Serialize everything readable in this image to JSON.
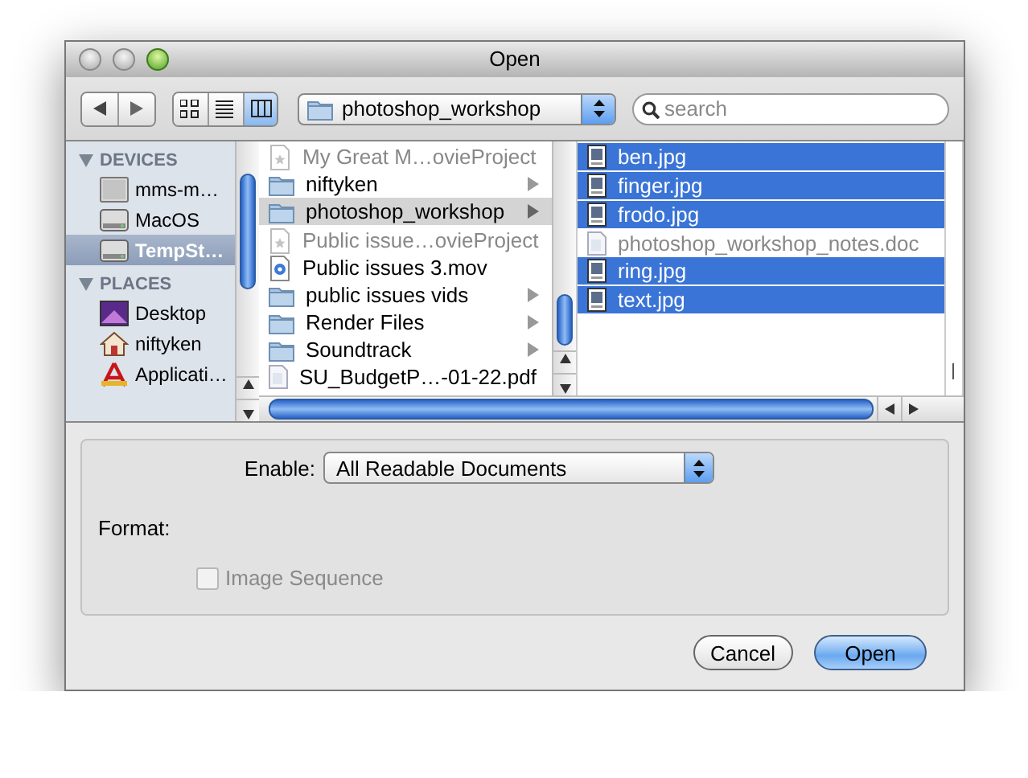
{
  "window": {
    "title": "Open"
  },
  "toolbar": {
    "view_modes": [
      {
        "kind": "icons",
        "selected": false
      },
      {
        "kind": "list",
        "selected": false
      },
      {
        "kind": "columns",
        "selected": true
      }
    ],
    "location": "photoshop_workshop",
    "search": {
      "placeholder": "search"
    }
  },
  "sidebar": {
    "sections": [
      {
        "title": "DEVICES",
        "expanded": true,
        "items": [
          {
            "label": "mms-m…",
            "kind": "computer",
            "selected": false
          },
          {
            "label": "MacOS",
            "kind": "disk",
            "selected": false
          },
          {
            "label": "TempSt…",
            "kind": "disk",
            "selected": true
          }
        ]
      },
      {
        "title": "PLACES",
        "expanded": true,
        "items": [
          {
            "label": "Desktop",
            "kind": "desktop",
            "selected": false
          },
          {
            "label": "niftyken",
            "kind": "home",
            "selected": false
          },
          {
            "label": "Applicati…",
            "kind": "apps",
            "selected": false
          }
        ]
      }
    ]
  },
  "columns": [
    {
      "items": [
        {
          "name": "My Great M…ovieProject",
          "kind": "project",
          "disabled": true,
          "selected": false
        },
        {
          "name": "niftyken",
          "kind": "folder",
          "disabled": false,
          "selected": false
        },
        {
          "name": "photoshop_workshop",
          "kind": "folder",
          "disabled": false,
          "selected": true
        },
        {
          "name": "Public issue…ovieProject",
          "kind": "project",
          "disabled": true,
          "selected": false
        },
        {
          "name": "Public issues 3.mov",
          "kind": "movie",
          "disabled": false,
          "selected": false
        },
        {
          "name": "public issues vids",
          "kind": "folder",
          "disabled": false,
          "selected": false
        },
        {
          "name": "Render Files",
          "kind": "folder",
          "disabled": false,
          "selected": false
        },
        {
          "name": "Soundtrack",
          "kind": "folder",
          "disabled": false,
          "selected": false
        },
        {
          "name": "SU_BudgetP…-01-22.pdf",
          "kind": "document",
          "disabled": false,
          "selected": false
        }
      ]
    },
    {
      "items": [
        {
          "name": "ben.jpg",
          "kind": "image",
          "disabled": false,
          "selected": true
        },
        {
          "name": "finger.jpg",
          "kind": "image",
          "disabled": false,
          "selected": true
        },
        {
          "name": "frodo.jpg",
          "kind": "image",
          "disabled": false,
          "selected": true
        },
        {
          "name": "photoshop_workshop_notes.doc",
          "kind": "document",
          "disabled": true,
          "selected": false
        },
        {
          "name": "ring.jpg",
          "kind": "image",
          "disabled": false,
          "selected": true
        },
        {
          "name": "text.jpg",
          "kind": "image",
          "disabled": false,
          "selected": true
        }
      ]
    }
  ],
  "accessory": {
    "enable_label": "Enable:",
    "enable_value": "All Readable Documents",
    "format_label": "Format:",
    "image_sequence": {
      "label": "Image Sequence",
      "checked": false,
      "disabled": true
    }
  },
  "buttons": [
    {
      "label": "Cancel",
      "default": false
    },
    {
      "label": "Open",
      "default": true
    }
  ]
}
